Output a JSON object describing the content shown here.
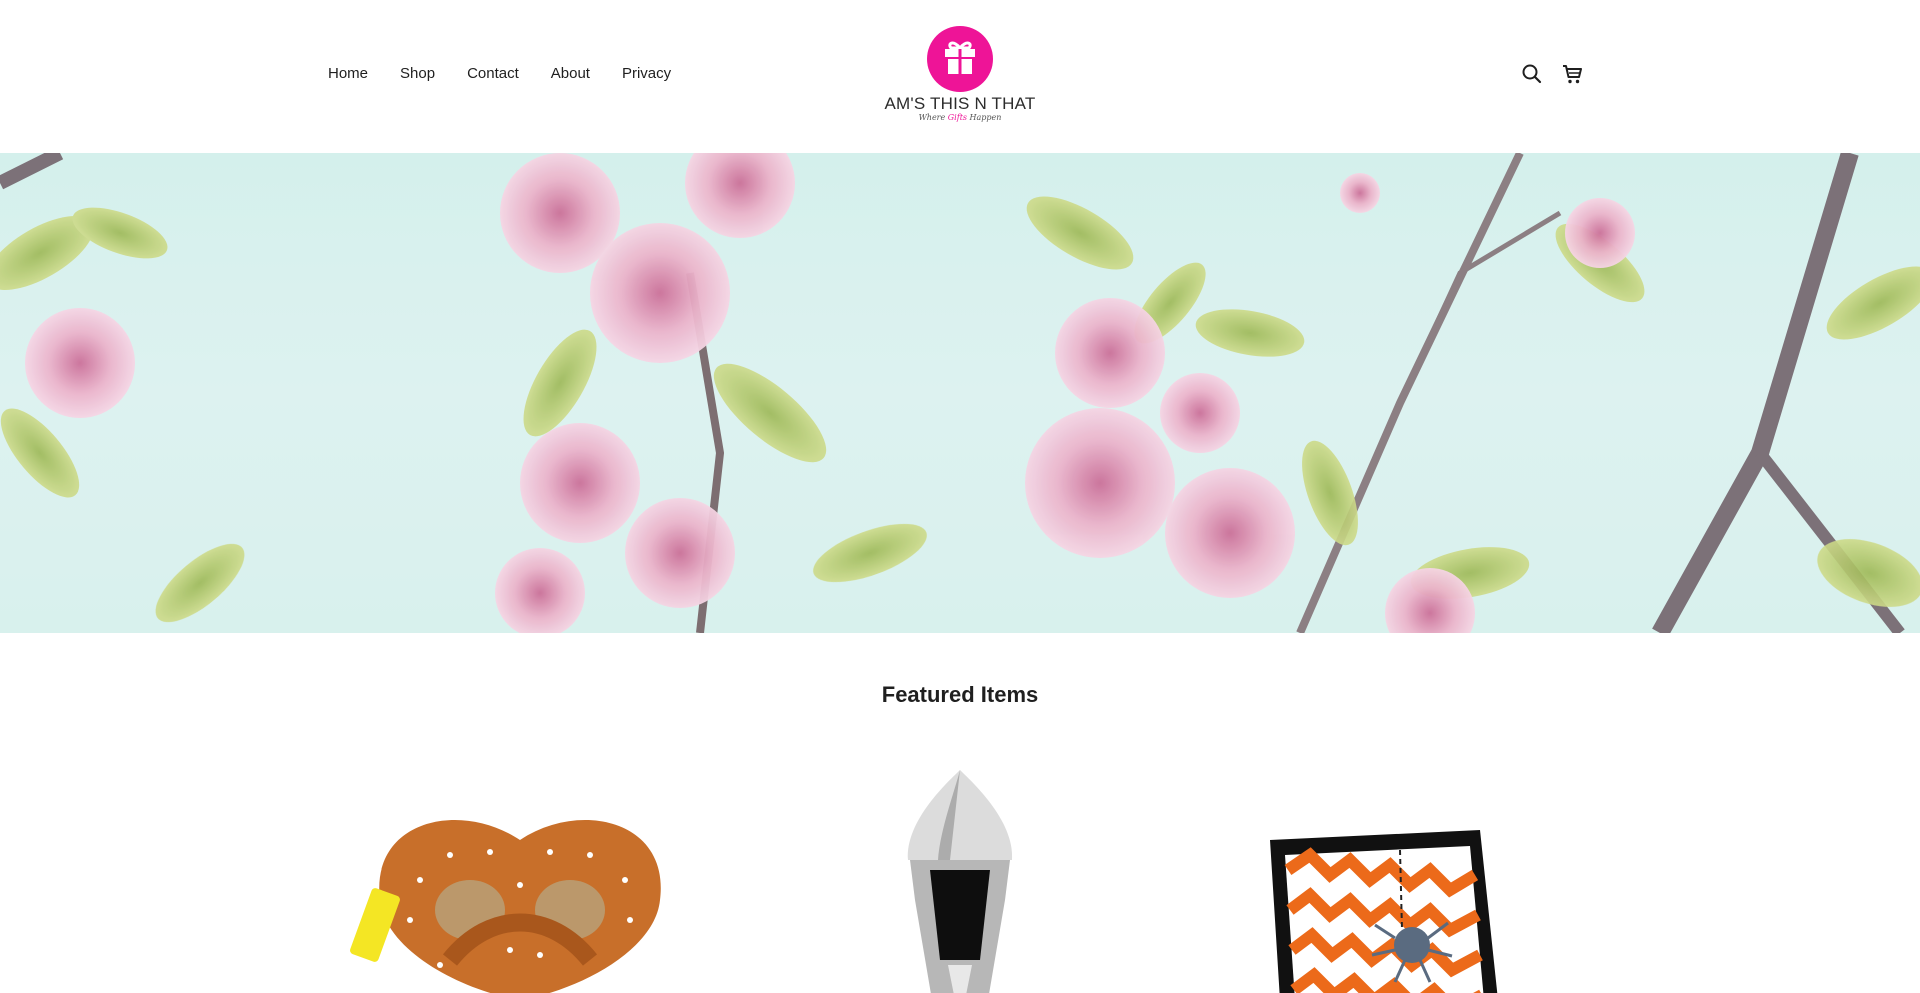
{
  "nav": {
    "items": [
      "Home",
      "Shop",
      "Contact",
      "About",
      "Privacy"
    ]
  },
  "brand": {
    "name": "AM'S THIS N THAT",
    "tagline_pre": "Where ",
    "tagline_mid": "Gifts",
    "tagline_post": " Happen",
    "accent_color": "#ee1497"
  },
  "header_icons": [
    "search-icon",
    "cart-icon"
  ],
  "featured": {
    "title": "Featured Items",
    "products": [
      "pretzel-bag-image",
      "makeup-brush-image",
      "halloween-pillow-image"
    ]
  }
}
